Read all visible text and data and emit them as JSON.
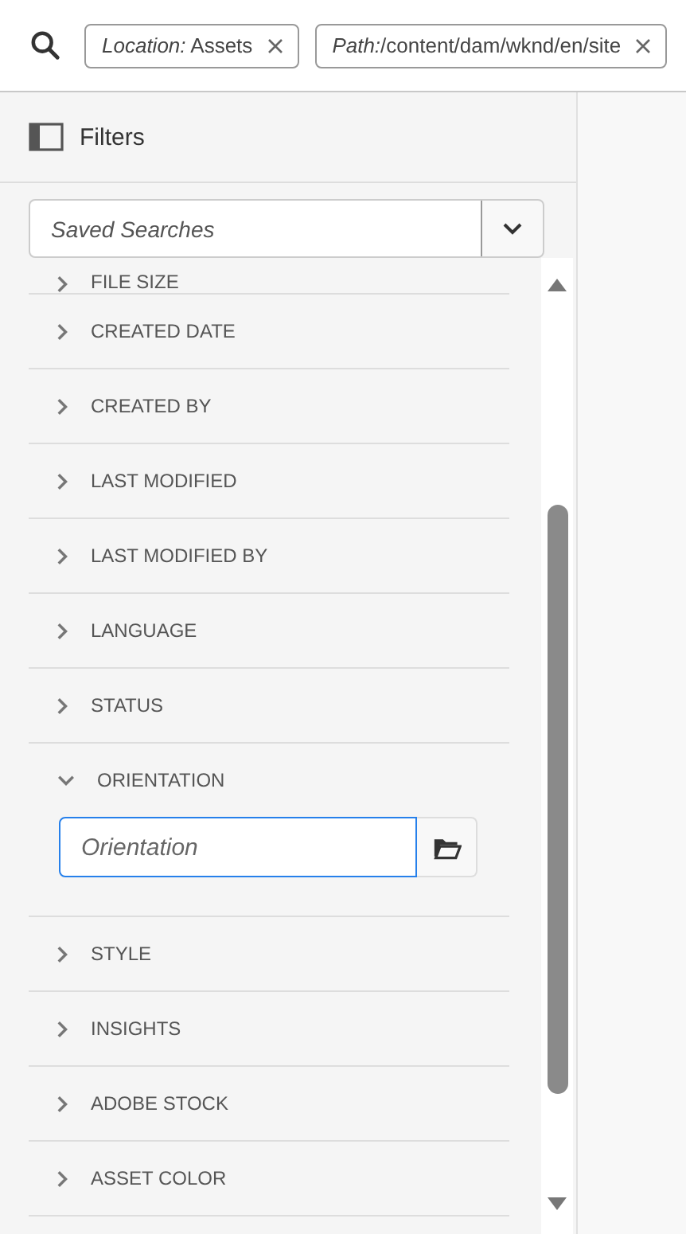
{
  "search_bar": {
    "tags": [
      {
        "key": "Location:",
        "value": " Assets"
      },
      {
        "key": "Path:",
        "value": "/content/dam/wknd/en/site"
      }
    ]
  },
  "filters_header": {
    "title": "Filters"
  },
  "saved_searches": {
    "placeholder": "Saved Searches"
  },
  "filter_sections": [
    {
      "label": "FILE SIZE",
      "expanded": false
    },
    {
      "label": "CREATED DATE",
      "expanded": false
    },
    {
      "label": "CREATED BY",
      "expanded": false
    },
    {
      "label": "LAST MODIFIED",
      "expanded": false
    },
    {
      "label": "LAST MODIFIED BY",
      "expanded": false
    },
    {
      "label": "LANGUAGE",
      "expanded": false
    },
    {
      "label": "STATUS",
      "expanded": false
    },
    {
      "label": "ORIENTATION",
      "expanded": true,
      "placeholder": "Orientation"
    },
    {
      "label": "STYLE",
      "expanded": false
    },
    {
      "label": "INSIGHTS",
      "expanded": false
    },
    {
      "label": "ADOBE STOCK",
      "expanded": false
    },
    {
      "label": "ASSET COLOR",
      "expanded": false
    }
  ]
}
